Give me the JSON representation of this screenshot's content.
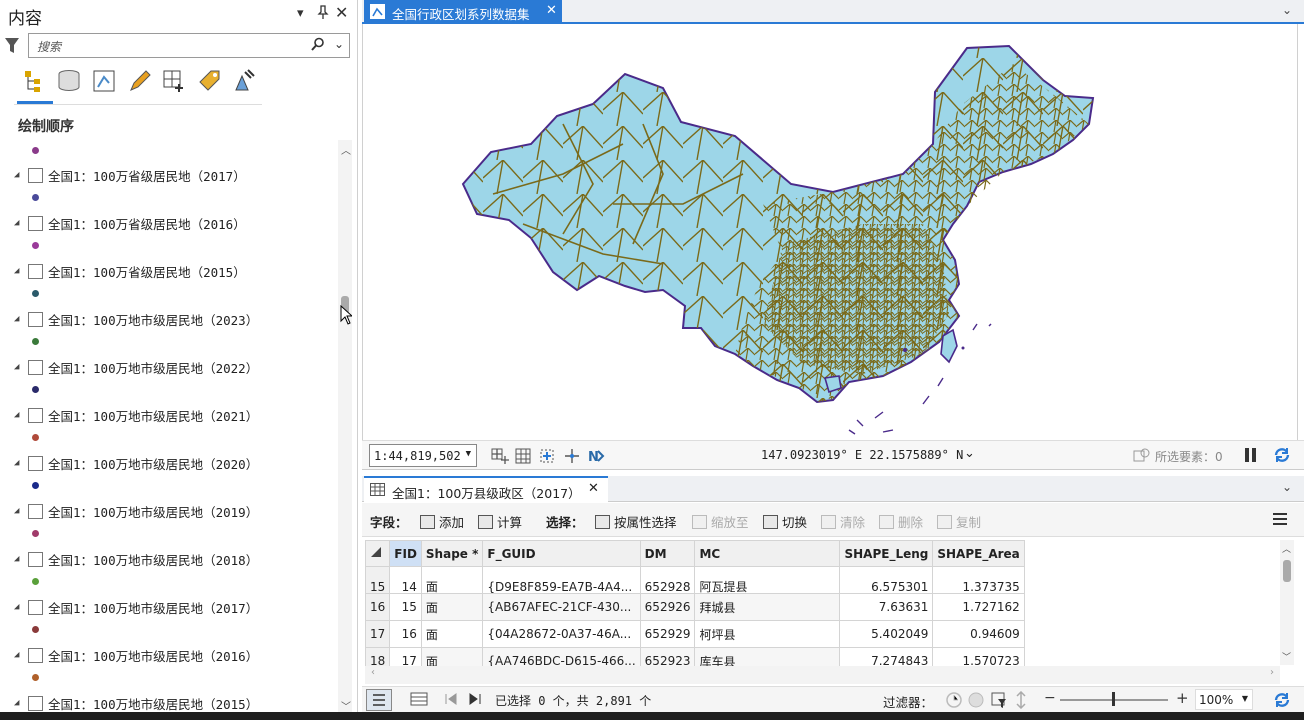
{
  "left_pane": {
    "title": "内容",
    "search_placeholder": "搜索",
    "section_title": "绘制顺序",
    "layers": [
      {
        "label": "全国1：100万省级居民地（2017）",
        "color": "#4a4a9a"
      },
      {
        "label": "全国1：100万省级居民地（2016）",
        "color": "#9a3a9a"
      },
      {
        "label": "全国1：100万省级居民地（2015）",
        "color": "#2a5a6a"
      },
      {
        "label": "全国1：100万地市级居民地（2023）",
        "color": "#3a7a3a"
      },
      {
        "label": "全国1：100万地市级居民地（2022）",
        "color": "#2a2a6a"
      },
      {
        "label": "全国1：100万地市级居民地（2021）",
        "color": "#b04a3a"
      },
      {
        "label": "全国1：100万地市级居民地（2020）",
        "color": "#1a2a8a"
      },
      {
        "label": "全国1：100万地市级居民地（2019）",
        "color": "#a03a6a"
      },
      {
        "label": "全国1：100万地市级居民地（2018）",
        "color": "#5aa03a"
      },
      {
        "label": "全国1：100万地市级居民地（2017）",
        "color": "#8a3a3a"
      },
      {
        "label": "全国1：100万地市级居民地（2016）",
        "color": "#b0602a"
      },
      {
        "label": "全国1：100万地市级居民地（2015）",
        "color": "#6a3a8a"
      }
    ],
    "top_dot_color": "#8a3a8a"
  },
  "map_view": {
    "tab_title": "全国行政区划系列数据集",
    "scale": "1:44,819,502",
    "coordinates": "147.0923019° E 22.1575889° N",
    "selected_features": "所选要素：0"
  },
  "attribute_table": {
    "tab_title": "全国1：100万县级政区（2017）",
    "toolbar": {
      "fields_label": "字段：",
      "add": "添加",
      "calculate": "计算",
      "selection_label": "选择：",
      "select_by_attr": "按属性选择",
      "zoom_to": "缩放至",
      "switch": "切换",
      "clear": "清除",
      "delete": "删除",
      "copy": "复制"
    },
    "columns": [
      "FID",
      "Shape *",
      "F_GUID",
      "DM",
      "MC",
      "SHAPE_Leng",
      "SHAPE_Area"
    ],
    "rows": [
      {
        "n": "15",
        "fid": "14",
        "shape": "面",
        "guid": "{D9E8F859-EA7B-4A4...",
        "dm": "652928",
        "mc": "阿瓦提县",
        "leng": "6.575301",
        "area": "1.373735"
      },
      {
        "n": "16",
        "fid": "15",
        "shape": "面",
        "guid": "{AB67AFEC-21CF-430...",
        "dm": "652926",
        "mc": "拜城县",
        "leng": "7.63631",
        "area": "1.727162"
      },
      {
        "n": "17",
        "fid": "16",
        "shape": "面",
        "guid": "{04A28672-0A37-46A...",
        "dm": "652929",
        "mc": "柯坪县",
        "leng": "5.402049",
        "area": "0.94609"
      },
      {
        "n": "18",
        "fid": "17",
        "shape": "面",
        "guid": "{AA746BDC-D615-466...",
        "dm": "652923",
        "mc": "库车县",
        "leng": "7.274843",
        "area": "1.570723"
      }
    ],
    "footer": {
      "status": "已选择 0 个，共 2,891 个",
      "filter_label": "过滤器：",
      "zoom": "100%"
    }
  },
  "colors": {
    "accent": "#2a7ad5",
    "map_fill": "#9dd6e8",
    "map_border": "#7a6a1a",
    "map_outline": "#4a2a8a"
  }
}
